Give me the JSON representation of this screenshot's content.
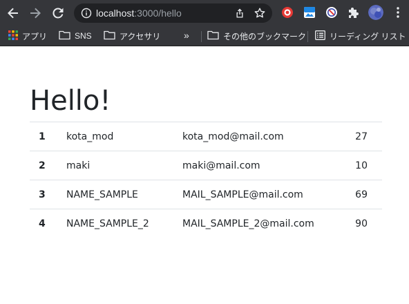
{
  "browser": {
    "url_host": "localhost",
    "url_path": ":3000/hello",
    "bookmarks": [
      {
        "label": "アプリ",
        "icon": "apps-grid-icon"
      },
      {
        "label": "SNS",
        "icon": "folder-icon"
      },
      {
        "label": "アクセサリ",
        "icon": "folder-icon"
      }
    ],
    "more_label": "»",
    "other_bookmarks": {
      "label": "その他のブックマーク",
      "icon": "folder-icon"
    },
    "reading_list": {
      "label": "リーディング リスト",
      "icon": "reading-list-icon"
    },
    "colors": {
      "toolbar": "#35363a",
      "omnibox": "#202124",
      "text": "#e8eaed",
      "muted": "#9aa0a6"
    }
  },
  "page": {
    "title": "Hello!",
    "rows": [
      {
        "id": "1",
        "name": "kota_mod",
        "mail": "kota_mod@mail.com",
        "age": "27"
      },
      {
        "id": "2",
        "name": "maki",
        "mail": "maki@mail.com",
        "age": "10"
      },
      {
        "id": "3",
        "name": "NAME_SAMPLE",
        "mail": "MAIL_SAMPLE@mail.com",
        "age": "69"
      },
      {
        "id": "4",
        "name": "NAME_SAMPLE_2",
        "mail": "MAIL_SAMPLE_2@mail.com",
        "age": "90"
      }
    ],
    "colors": {
      "text": "#212529",
      "border": "#dee2e6"
    }
  }
}
